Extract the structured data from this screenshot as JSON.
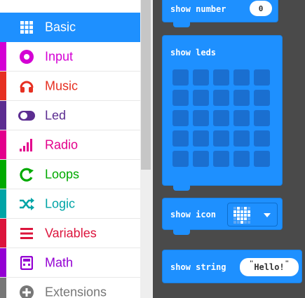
{
  "sidebar": {
    "categories": [
      {
        "label": "Basic",
        "color": "#1e90ff",
        "icon": "grid-icon",
        "selected": true
      },
      {
        "label": "Input",
        "color": "#d400d4",
        "icon": "target-icon",
        "selected": false
      },
      {
        "label": "Music",
        "color": "#e63022",
        "icon": "headphones-icon",
        "selected": false
      },
      {
        "label": "Led",
        "color": "#5c2d91",
        "icon": "toggle-icon",
        "selected": false
      },
      {
        "label": "Radio",
        "color": "#e3008c",
        "icon": "signal-bars-icon",
        "selected": false
      },
      {
        "label": "Loops",
        "color": "#00aa00",
        "icon": "loop-arrow-icon",
        "selected": false
      },
      {
        "label": "Logic",
        "color": "#00a4a6",
        "icon": "shuffle-icon",
        "selected": false
      },
      {
        "label": "Variables",
        "color": "#dc143c",
        "icon": "lines-icon",
        "selected": false
      },
      {
        "label": "Math",
        "color": "#9400d3",
        "icon": "calculator-icon",
        "selected": false
      },
      {
        "label": "Extensions",
        "color": "#777777",
        "icon": "plus-circle-icon",
        "selected": false
      }
    ]
  },
  "workspace": {
    "background": "#4a4a4a",
    "blocks": {
      "show_number": {
        "label": "show number",
        "value": "0"
      },
      "show_leds": {
        "label": "show leds"
      },
      "show_icon": {
        "label": "show icon",
        "value_icon": "heart-icon"
      },
      "show_string": {
        "label": "show string",
        "value": "Hello!",
        "quote_open": "\"",
        "quote_close": "\""
      }
    },
    "block_color": "#1e90ff"
  }
}
